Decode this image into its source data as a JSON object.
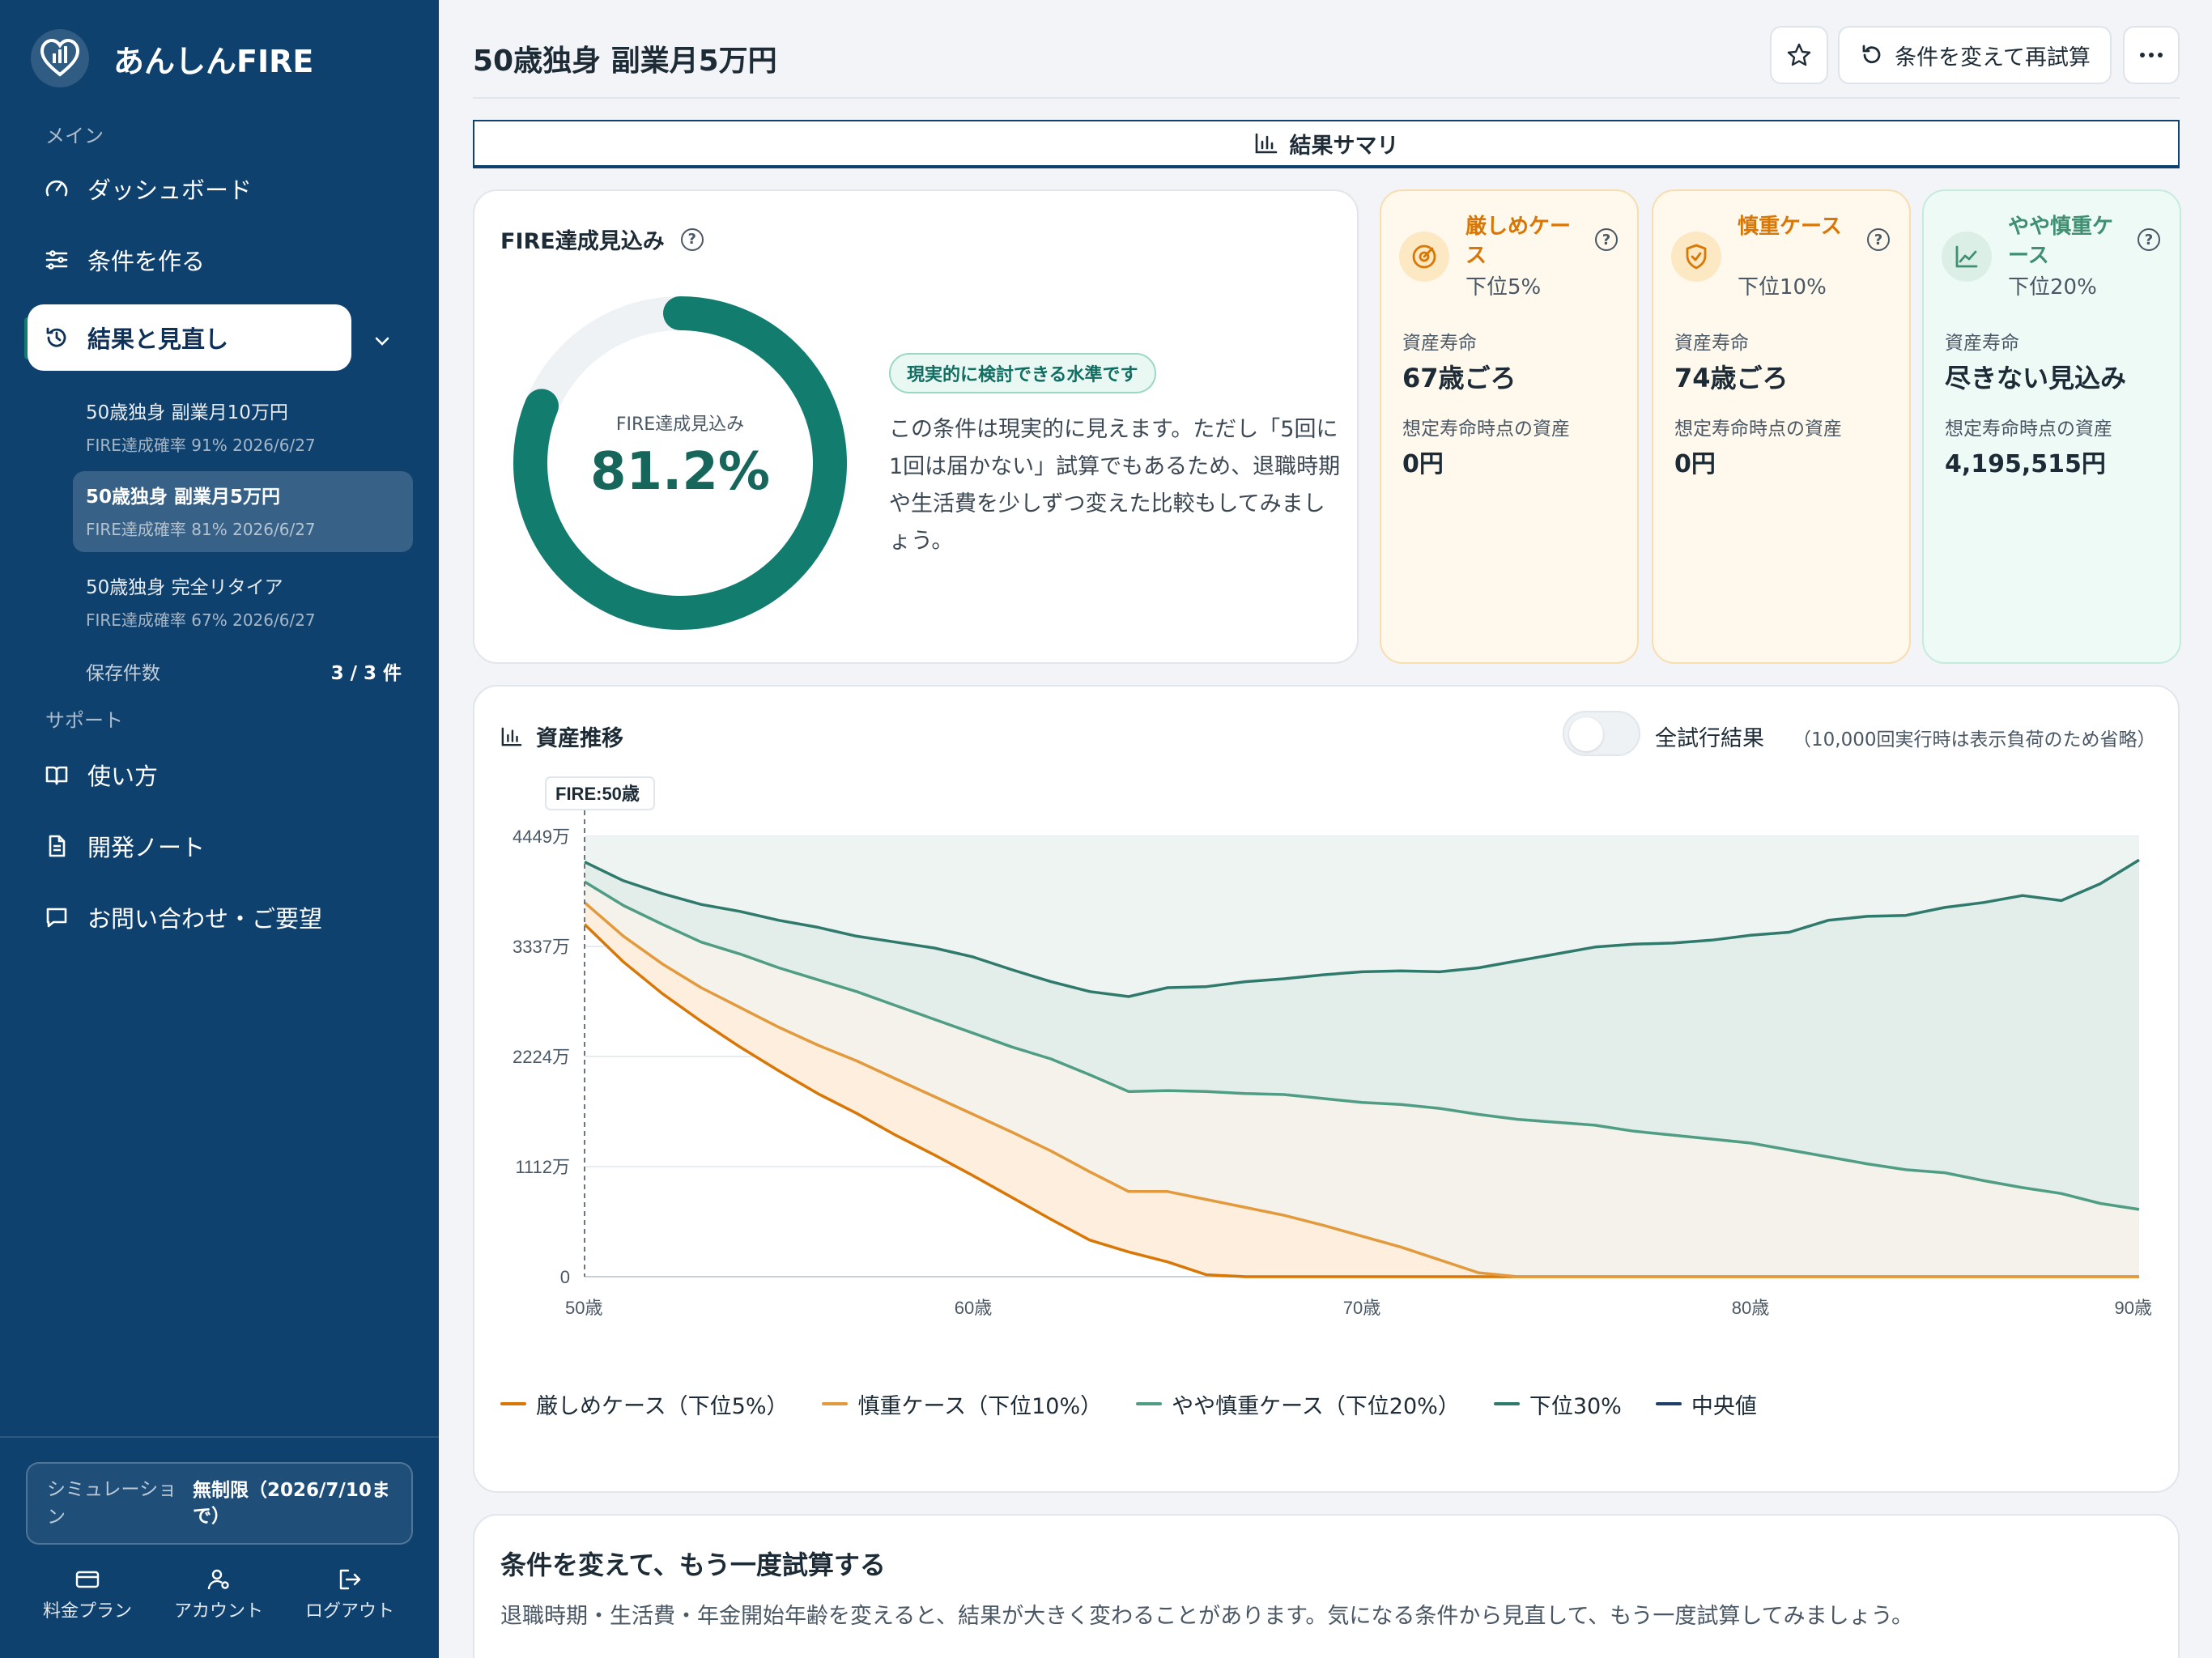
{
  "app": {
    "name": "あんしんFIRE"
  },
  "sidebar": {
    "main_label": "メイン",
    "nav": [
      {
        "label": "ダッシュボード",
        "icon": "gauge-icon"
      },
      {
        "label": "条件を作る",
        "icon": "sliders-icon"
      },
      {
        "label": "結果と見直し",
        "icon": "history-icon"
      }
    ],
    "results": [
      {
        "title": "50歳独身 副業月10万円",
        "sub": "FIRE達成確率 91% 2026/6/27"
      },
      {
        "title": "50歳独身 副業月5万円",
        "sub": "FIRE達成確率 81% 2026/6/27"
      },
      {
        "title": "50歳独身 完全リタイア",
        "sub": "FIRE達成確率 67% 2026/6/27"
      }
    ],
    "save_count_label": "保存件数",
    "save_count_value": "3 / 3 件",
    "support_label": "サポート",
    "support": [
      {
        "label": "使い方",
        "icon": "book-icon"
      },
      {
        "label": "開発ノート",
        "icon": "document-icon"
      },
      {
        "label": "お問い合わせ・ご要望",
        "icon": "chat-icon"
      }
    ],
    "simulation_key": "シミュレーション",
    "simulation_value": "無制限（2026/7/10まで）",
    "footer": [
      {
        "label": "料金プラン",
        "icon": "card-icon"
      },
      {
        "label": "アカウント",
        "icon": "account-icon"
      },
      {
        "label": "ログアウト",
        "icon": "logout-icon"
      }
    ]
  },
  "header": {
    "title": "50歳独身 副業月5万円",
    "retry_button": "条件を変えて再試算",
    "tab": "結果サマリ"
  },
  "fire": {
    "title": "FIRE達成見込み",
    "inner_label": "FIRE達成見込み",
    "value": "81.2%",
    "probability": 0.812,
    "badge": "現実的に検討できる水準です",
    "description": "この条件は現実的に見えます。ただし「5回に1回は届かない」試算でもあるため、退職時期や生活費を少しずつ変えた比較もしてみましょう。"
  },
  "scenarios": [
    {
      "name": "厳しめケース",
      "sub": "下位5%",
      "k1": "資産寿命",
      "v1": "67歳ごろ",
      "k2": "想定寿命時点の資産",
      "v2": "0円",
      "icon": "target-icon",
      "accent": "#d97706"
    },
    {
      "name": "慎重ケース",
      "sub": "下位10%",
      "k1": "資産寿命",
      "v1": "74歳ごろ",
      "k2": "想定寿命時点の資産",
      "v2": "0円",
      "icon": "shield-icon",
      "accent": "#d97706"
    },
    {
      "name": "やや慎重ケース",
      "sub": "下位20%",
      "k1": "資産寿命",
      "v1": "尽きない見込み",
      "k2": "想定寿命時点の資産",
      "v2": "4,195,515円",
      "icon": "trend-icon",
      "accent": "#3f8f73"
    }
  ],
  "asset_chart": {
    "title": "資産推移",
    "toggle_label": "全試行結果",
    "toggle_note": "（10,000回実行時は表示負荷のため省略）",
    "fire_marker": "FIRE:50歳"
  },
  "chart_data": {
    "type": "area",
    "x_ticks": [
      "50歳",
      "60歳",
      "70歳",
      "80歳",
      "90歳"
    ],
    "y_ticks": [
      "0",
      "1112万",
      "2224万",
      "3337万",
      "4449万"
    ],
    "xlim": [
      50,
      90
    ],
    "ylim": [
      0,
      4449
    ],
    "fire_age": 50,
    "series": [
      {
        "name": "厳しめケース（下位5%）",
        "color": "#d97706",
        "x": [
          50,
          51,
          52,
          53,
          54,
          55,
          56,
          57,
          58,
          59,
          60,
          61,
          62,
          63,
          64,
          65,
          66,
          67,
          90
        ],
        "y": [
          3560,
          3180,
          2860,
          2580,
          2320,
          2080,
          1850,
          1650,
          1430,
          1230,
          1020,
          800,
          580,
          370,
          250,
          150,
          20,
          0,
          0
        ]
      },
      {
        "name": "慎重ケース（下位10%）",
        "color": "#e39a3c",
        "x": [
          50,
          51,
          52,
          53,
          54,
          55,
          56,
          57,
          58,
          59,
          60,
          61,
          62,
          63,
          64,
          65,
          66,
          67,
          68,
          69,
          70,
          71,
          72,
          73,
          74,
          90
        ],
        "y": [
          3780,
          3440,
          3160,
          2920,
          2720,
          2520,
          2340,
          2180,
          2000,
          1820,
          1640,
          1460,
          1270,
          1060,
          860,
          860,
          780,
          700,
          620,
          520,
          410,
          300,
          170,
          40,
          0,
          0
        ]
      },
      {
        "name": "やや慎重ケース（下位20%）",
        "color": "#4f9d84",
        "x": [
          50,
          51,
          52,
          53,
          54,
          55,
          56,
          57,
          58,
          59,
          60,
          61,
          62,
          63,
          64,
          65,
          66,
          67,
          68,
          69,
          70,
          71,
          72,
          73,
          74,
          75,
          76,
          77,
          78,
          79,
          80,
          81,
          82,
          83,
          84,
          85,
          86,
          87,
          88,
          89,
          90
        ],
        "y": [
          3990,
          3750,
          3560,
          3380,
          3260,
          3120,
          3000,
          2880,
          2740,
          2600,
          2460,
          2320,
          2200,
          2040,
          1870,
          1880,
          1870,
          1850,
          1840,
          1800,
          1760,
          1740,
          1700,
          1640,
          1590,
          1560,
          1530,
          1470,
          1430,
          1390,
          1350,
          1280,
          1210,
          1140,
          1080,
          1050,
          970,
          900,
          840,
          740,
          680
        ]
      },
      {
        "name": "下位30%",
        "color": "#2f7a6c",
        "x": [
          50,
          51,
          52,
          53,
          54,
          55,
          56,
          57,
          58,
          59,
          60,
          61,
          62,
          63,
          64,
          65,
          66,
          67,
          68,
          69,
          70,
          71,
          72,
          73,
          74,
          75,
          76,
          77,
          78,
          79,
          80,
          81,
          82,
          83,
          84,
          85,
          86,
          87,
          88,
          89,
          90
        ],
        "y": [
          4190,
          4000,
          3870,
          3760,
          3690,
          3600,
          3530,
          3440,
          3380,
          3320,
          3230,
          3100,
          2980,
          2880,
          2830,
          2920,
          2930,
          2980,
          3010,
          3050,
          3080,
          3090,
          3080,
          3120,
          3190,
          3260,
          3330,
          3360,
          3370,
          3400,
          3450,
          3480,
          3600,
          3640,
          3650,
          3730,
          3780,
          3850,
          3800,
          3970,
          4210
        ]
      },
      {
        "name": "中央値",
        "color": "#1f3f6b",
        "x": [],
        "y": []
      }
    ]
  },
  "retry": {
    "title": "条件を変えて、もう一度試算する",
    "text": "退職時期・生活費・年金開始年齢を変えると、結果が大きく変わることがあります。気になる条件から見直して、もう一度試算してみましょう。"
  }
}
